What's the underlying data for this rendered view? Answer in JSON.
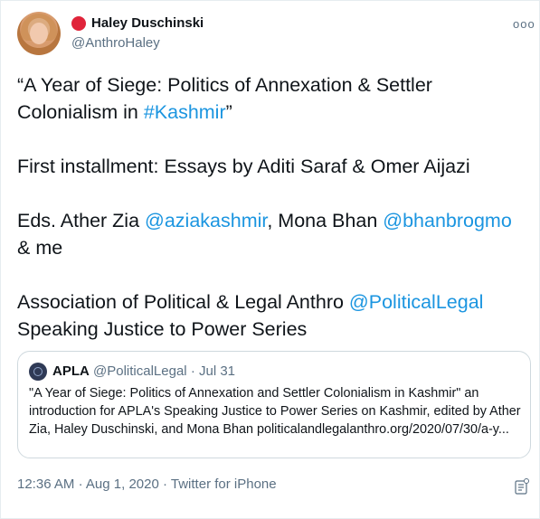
{
  "author": {
    "name": "Haley Duschinski",
    "handle": "@AnthroHaley"
  },
  "more_label": "ooo",
  "body": {
    "p1_prefix": "“A Year of Siege: Politics of Annexation & Settler Colonialism in ",
    "p1_hashtag": "#Kashmir",
    "p1_suffix": "”",
    "p2": "First installment: Essays by Aditi Saraf & Omer Aijazi",
    "p3_prefix": "Eds. Ather Zia ",
    "p3_mention1": "@aziakashmir",
    "p3_mid": ", Mona Bhan ",
    "p3_mention2": "@bhanbrogmo",
    "p3_suffix": " & me",
    "p4_prefix": "Association of Political & Legal Anthro ",
    "p4_mention": "@PoliticalLegal",
    "p4_suffix": " Speaking Justice to Power Series"
  },
  "quote": {
    "name": "APLA",
    "handle": "@PoliticalLegal",
    "separator": "·",
    "date": "Jul 31",
    "text": "\"A Year of Siege: Politics of Annexation and Settler Colonialism in Kashmir\" an introduction for APLA's Speaking Justice to Power Series on Kashmir, edited by Ather Zia, Haley Duschinski, and Mona Bhan",
    "link": "politicalandlegalanthro.org/2020/07/30/a-y..."
  },
  "footer": {
    "time": "12:36 AM",
    "sep": "·",
    "date": "Aug 1, 2020",
    "source": "Twitter for iPhone"
  },
  "colors": {
    "link": "#1b95e0",
    "badge": "#e0243a",
    "muted": "#5b7083"
  }
}
